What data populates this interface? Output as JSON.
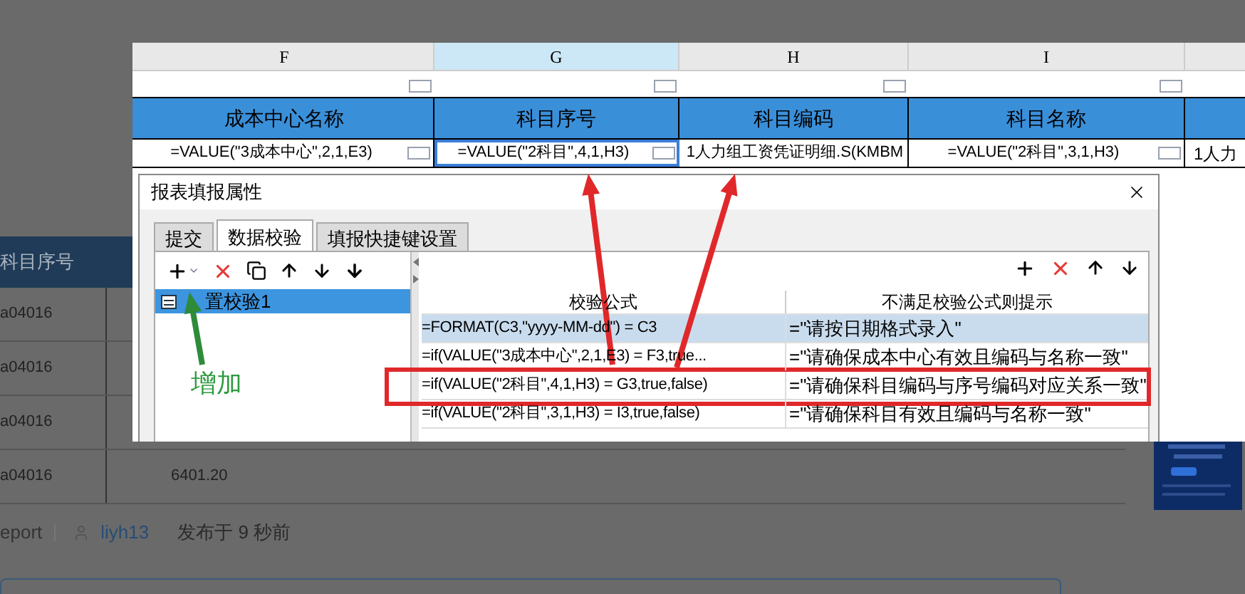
{
  "background_page": {
    "table_header": "科目序号",
    "rows": [
      {
        "code": "a04016"
      },
      {
        "code": "a04016"
      },
      {
        "code": "a04016"
      },
      {
        "code": "a04016",
        "amount": "6401.20"
      }
    ],
    "byline": {
      "category": "eport",
      "author": "liyh13",
      "posted": "发布于 9 秒前"
    }
  },
  "spreadsheet": {
    "columns": [
      {
        "letter": "F",
        "selected": false
      },
      {
        "letter": "G",
        "selected": true
      },
      {
        "letter": "H",
        "selected": false
      },
      {
        "letter": "I",
        "selected": false
      }
    ],
    "headers": [
      "成本中心名称",
      "科目序号",
      "科目编码",
      "科目名称"
    ],
    "cells": [
      {
        "text": "=VALUE(\"3成本中心\",2,1,E3)",
        "selected": false
      },
      {
        "text": "=VALUE(\"2科目\",4,1,H3)",
        "selected": true
      },
      {
        "text": "1人力组工资凭证明细.S(KMBM",
        "selected": false
      },
      {
        "text": "=VALUE(\"2科目\",3,1,H3)",
        "selected": false
      }
    ],
    "partial_cell": "1人力"
  },
  "dialog": {
    "title": "报表填报属性",
    "tabs": [
      {
        "label": "提交",
        "selected": false
      },
      {
        "label": "数据校验",
        "selected": true
      },
      {
        "label": "填报快捷键设置",
        "selected": false
      }
    ],
    "checks": [
      {
        "name": "置校验1",
        "selected": true
      }
    ],
    "table": {
      "columns": [
        "校验公式",
        "不满足校验公式则提示"
      ],
      "rows": [
        {
          "formula": "=FORMAT(C3,\"yyyy-MM-dd\") = C3",
          "message": "=\"请按日期格式录入\"",
          "selected": true
        },
        {
          "formula": "=if(VALUE(\"3成本中心\",2,1,E3) = F3,true...",
          "message": "=\"请确保成本中心有效且编码与名称一致\"",
          "selected": false
        },
        {
          "formula": "=if(VALUE(\"2科目\",4,1,H3) = G3,true,false)",
          "message": "=\"请确保科目编码与序号编码对应关系一致\"",
          "selected": false
        },
        {
          "formula": "=if(VALUE(\"2科目\",3,1,H3) = I3,true,false)",
          "message": "=\"请确保科目有效且编码与名称一致\"",
          "selected": false
        }
      ]
    }
  },
  "annotation": {
    "label": "增加"
  }
}
